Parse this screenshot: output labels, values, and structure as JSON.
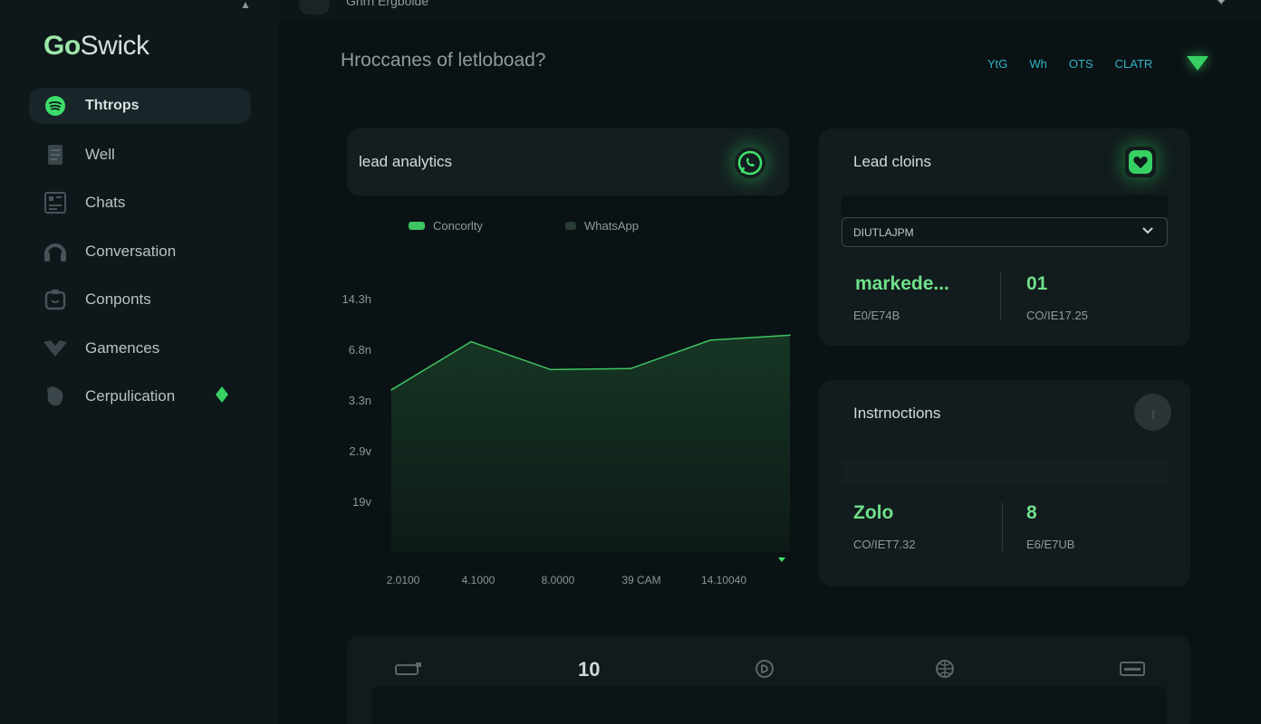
{
  "app": {
    "logo_prefix": "Go",
    "logo_suffix": "Swick"
  },
  "topbar": {
    "tab_label": "Gnrn Ergbolde",
    "corner_glyph": "✦"
  },
  "sidebar": {
    "items": [
      {
        "label": "Thtrops",
        "icon": "spotify-icon"
      },
      {
        "label": "Well",
        "icon": "document-icon"
      },
      {
        "label": "Chats",
        "icon": "grid-chat-icon"
      },
      {
        "label": "Conversation",
        "icon": "headset-icon"
      },
      {
        "label": "Conponts",
        "icon": "component-box-icon"
      },
      {
        "label": "Gamences",
        "icon": "heart-icon"
      },
      {
        "label": "Cerpulication",
        "icon": "puzzle-icon"
      }
    ]
  },
  "header": {
    "title": "Hroccanes of letloboad?",
    "filters": [
      "YtG",
      "Wh",
      "OTS",
      "CLATR"
    ]
  },
  "lead_analytics": {
    "title": "lead analytics",
    "legend": [
      "Concorlty",
      "WhatsApp"
    ]
  },
  "chart_data": {
    "type": "area",
    "x": [
      "2.0100",
      "4.1000",
      "8.0000",
      "39 CAM",
      "14.10040"
    ],
    "y_ticks": [
      "14.3h",
      "6.8n",
      "3.3n",
      "2.9v",
      "19v"
    ],
    "series": [
      {
        "name": "Concorlty",
        "values": [
          4.2,
          5.15,
          4.6,
          4.62,
          5.18,
          5.28
        ]
      }
    ],
    "ylim": [
      1,
      6
    ],
    "colors": {
      "line": "#3ec462",
      "fill": "#12281d"
    }
  },
  "lead_clicks": {
    "title": "Lead cloins",
    "select_value": "DIUTLAJPM",
    "stat1_value": "markede...",
    "stat1_sub": "E0/E74B",
    "stat2_value": "01",
    "stat2_sub": "CO/IE17.25"
  },
  "instructions": {
    "title": "Instrnoctions",
    "stat1_value": "Zolo",
    "stat1_sub": "CO/IET7.32",
    "stat2_value": "8",
    "stat2_sub": "E6/E7UB"
  },
  "bottom": {
    "number": "10",
    "icons": [
      "card-icon",
      "refresh-icon",
      "globe-icon",
      "keyboard-icon"
    ]
  },
  "colors": {
    "accent": "#32d15e",
    "bg": "#0b1215",
    "panel": "#121b1d"
  }
}
